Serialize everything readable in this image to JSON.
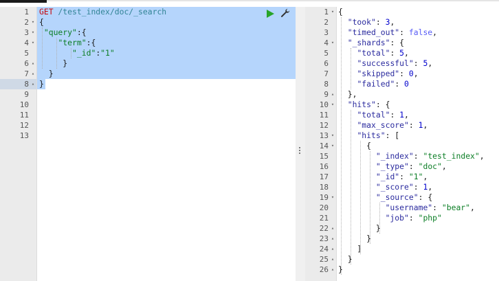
{
  "request_editor": {
    "lines": [
      {
        "n": "1",
        "fold": "",
        "parts": [
          [
            "kw-method",
            "GET"
          ],
          [
            "kw-url",
            " /test_index/doc/_search"
          ]
        ]
      },
      {
        "n": "2",
        "fold": "▾",
        "parts": [
          [
            "tok-punc",
            "{"
          ]
        ]
      },
      {
        "n": "3",
        "fold": "▾",
        "parts": [
          [
            "tok-punc",
            " "
          ],
          [
            "tok-str",
            "\"query\""
          ],
          [
            "tok-punc",
            ":{"
          ]
        ]
      },
      {
        "n": "4",
        "fold": "▾",
        "parts": [
          [
            "tok-punc",
            "    "
          ],
          [
            "tok-str",
            "\"term\""
          ],
          [
            "tok-punc",
            ":{"
          ]
        ]
      },
      {
        "n": "5",
        "fold": "",
        "parts": [
          [
            "tok-punc",
            "       "
          ],
          [
            "tok-str",
            "\"_id\""
          ],
          [
            "tok-punc",
            ":"
          ],
          [
            "tok-str",
            "\"1\""
          ]
        ]
      },
      {
        "n": "6",
        "fold": "▴",
        "parts": [
          [
            "tok-punc",
            "     }"
          ]
        ]
      },
      {
        "n": "7",
        "fold": "▴",
        "parts": [
          [
            "tok-punc",
            "  }"
          ]
        ]
      },
      {
        "n": "8",
        "fold": "▴",
        "parts": [
          [
            "tok-punc",
            "}"
          ]
        ]
      },
      {
        "n": "9",
        "fold": "",
        "parts": []
      },
      {
        "n": "10",
        "fold": "",
        "parts": []
      },
      {
        "n": "11",
        "fold": "",
        "parts": []
      },
      {
        "n": "12",
        "fold": "",
        "parts": []
      },
      {
        "n": "13",
        "fold": "",
        "parts": []
      }
    ],
    "icons": {
      "run": "play-icon",
      "settings": "wrench-icon"
    },
    "colors": {
      "selection": "#b5d5fc",
      "run": "#28a428",
      "method": "#c5060b",
      "url": "#318495"
    }
  },
  "response_viewer": {
    "lines": [
      {
        "n": "1",
        "fold": "▾",
        "parts": [
          [
            "tok-punc",
            "{"
          ]
        ]
      },
      {
        "n": "2",
        "fold": "",
        "parts": [
          [
            "tok-punc",
            "  "
          ],
          [
            "tok-key",
            "\"took\""
          ],
          [
            "tok-punc",
            ": "
          ],
          [
            "tok-num",
            "3"
          ],
          [
            "tok-punc",
            ","
          ]
        ]
      },
      {
        "n": "3",
        "fold": "",
        "parts": [
          [
            "tok-punc",
            "  "
          ],
          [
            "tok-key",
            "\"timed_out\""
          ],
          [
            "tok-punc",
            ": "
          ],
          [
            "tok-bool",
            "false"
          ],
          [
            "tok-punc",
            ","
          ]
        ]
      },
      {
        "n": "4",
        "fold": "▾",
        "parts": [
          [
            "tok-punc",
            "  "
          ],
          [
            "tok-key",
            "\"_shards\""
          ],
          [
            "tok-punc",
            ": {"
          ]
        ]
      },
      {
        "n": "5",
        "fold": "",
        "parts": [
          [
            "tok-punc",
            "    "
          ],
          [
            "tok-key",
            "\"total\""
          ],
          [
            "tok-punc",
            ": "
          ],
          [
            "tok-num",
            "5"
          ],
          [
            "tok-punc",
            ","
          ]
        ]
      },
      {
        "n": "6",
        "fold": "",
        "parts": [
          [
            "tok-punc",
            "    "
          ],
          [
            "tok-key",
            "\"successful\""
          ],
          [
            "tok-punc",
            ": "
          ],
          [
            "tok-num",
            "5"
          ],
          [
            "tok-punc",
            ","
          ]
        ]
      },
      {
        "n": "7",
        "fold": "",
        "parts": [
          [
            "tok-punc",
            "    "
          ],
          [
            "tok-key",
            "\"skipped\""
          ],
          [
            "tok-punc",
            ": "
          ],
          [
            "tok-num",
            "0"
          ],
          [
            "tok-punc",
            ","
          ]
        ]
      },
      {
        "n": "8",
        "fold": "",
        "parts": [
          [
            "tok-punc",
            "    "
          ],
          [
            "tok-key",
            "\"failed\""
          ],
          [
            "tok-punc",
            ": "
          ],
          [
            "tok-num",
            "0"
          ]
        ]
      },
      {
        "n": "9",
        "fold": "▴",
        "parts": [
          [
            "tok-punc",
            "  },"
          ]
        ]
      },
      {
        "n": "10",
        "fold": "▾",
        "parts": [
          [
            "tok-punc",
            "  "
          ],
          [
            "tok-key",
            "\"hits\""
          ],
          [
            "tok-punc",
            ": {"
          ]
        ]
      },
      {
        "n": "11",
        "fold": "",
        "parts": [
          [
            "tok-punc",
            "    "
          ],
          [
            "tok-key",
            "\"total\""
          ],
          [
            "tok-punc",
            ": "
          ],
          [
            "tok-num",
            "1"
          ],
          [
            "tok-punc",
            ","
          ]
        ]
      },
      {
        "n": "12",
        "fold": "",
        "parts": [
          [
            "tok-punc",
            "    "
          ],
          [
            "tok-key",
            "\"max_score\""
          ],
          [
            "tok-punc",
            ": "
          ],
          [
            "tok-num",
            "1"
          ],
          [
            "tok-punc",
            ","
          ]
        ]
      },
      {
        "n": "13",
        "fold": "▾",
        "parts": [
          [
            "tok-punc",
            "    "
          ],
          [
            "tok-key",
            "\"hits\""
          ],
          [
            "tok-punc",
            ": ["
          ]
        ]
      },
      {
        "n": "14",
        "fold": "▾",
        "parts": [
          [
            "tok-punc",
            "      {"
          ]
        ]
      },
      {
        "n": "15",
        "fold": "",
        "parts": [
          [
            "tok-punc",
            "        "
          ],
          [
            "tok-key",
            "\"_index\""
          ],
          [
            "tok-punc",
            ": "
          ],
          [
            "tok-str",
            "\"test_index\""
          ],
          [
            "tok-punc",
            ","
          ]
        ]
      },
      {
        "n": "16",
        "fold": "",
        "parts": [
          [
            "tok-punc",
            "        "
          ],
          [
            "tok-key",
            "\"_type\""
          ],
          [
            "tok-punc",
            ": "
          ],
          [
            "tok-str",
            "\"doc\""
          ],
          [
            "tok-punc",
            ","
          ]
        ]
      },
      {
        "n": "17",
        "fold": "",
        "parts": [
          [
            "tok-punc",
            "        "
          ],
          [
            "tok-key",
            "\"_id\""
          ],
          [
            "tok-punc",
            ": "
          ],
          [
            "tok-str",
            "\"1\""
          ],
          [
            "tok-punc",
            ","
          ]
        ]
      },
      {
        "n": "18",
        "fold": "",
        "parts": [
          [
            "tok-punc",
            "        "
          ],
          [
            "tok-key",
            "\"_score\""
          ],
          [
            "tok-punc",
            ": "
          ],
          [
            "tok-num",
            "1"
          ],
          [
            "tok-punc",
            ","
          ]
        ]
      },
      {
        "n": "19",
        "fold": "▾",
        "parts": [
          [
            "tok-punc",
            "        "
          ],
          [
            "tok-key",
            "\"_source\""
          ],
          [
            "tok-punc",
            ": {"
          ]
        ]
      },
      {
        "n": "20",
        "fold": "",
        "parts": [
          [
            "tok-punc",
            "          "
          ],
          [
            "tok-key",
            "\"username\""
          ],
          [
            "tok-punc",
            ": "
          ],
          [
            "tok-str",
            "\"bear\""
          ],
          [
            "tok-punc",
            ","
          ]
        ]
      },
      {
        "n": "21",
        "fold": "",
        "parts": [
          [
            "tok-punc",
            "          "
          ],
          [
            "tok-key",
            "\"job\""
          ],
          [
            "tok-punc",
            ": "
          ],
          [
            "tok-str",
            "\"php\""
          ]
        ]
      },
      {
        "n": "22",
        "fold": "▴",
        "parts": [
          [
            "tok-punc",
            "        }"
          ]
        ]
      },
      {
        "n": "23",
        "fold": "▴",
        "parts": [
          [
            "tok-punc",
            "      }"
          ]
        ]
      },
      {
        "n": "24",
        "fold": "▴",
        "parts": [
          [
            "tok-punc",
            "    ]"
          ]
        ]
      },
      {
        "n": "25",
        "fold": "▴",
        "parts": [
          [
            "tok-punc",
            "  }"
          ]
        ]
      },
      {
        "n": "26",
        "fold": "▴",
        "parts": [
          [
            "tok-punc",
            "}"
          ]
        ]
      }
    ]
  },
  "resizer": {
    "icon": "vertical-dots-icon"
  }
}
